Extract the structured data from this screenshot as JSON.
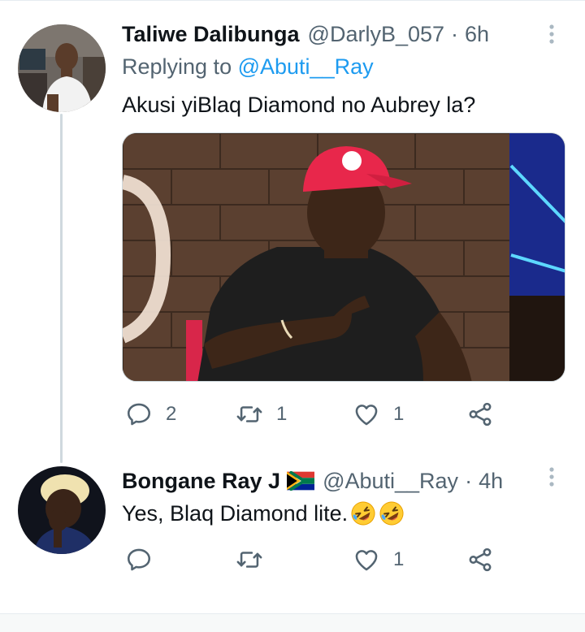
{
  "tweets": [
    {
      "name": "Taliwe Dalibunga",
      "handle": "@DarlyB_057",
      "separator": "·",
      "time": "6h",
      "replying_prefix": "Replying to",
      "replying_handle": "@Abuti__Ray",
      "text": "Akusi yiBlaq Diamond no Aubrey la?",
      "actions": {
        "replies": "2",
        "retweets": "1",
        "likes": "1"
      }
    },
    {
      "name": "Bongane Ray J",
      "flag_icon": "south-africa-flag",
      "handle": "@Abuti__Ray",
      "separator": "·",
      "time": "4h",
      "text": "Yes, Blaq Diamond lite.",
      "emoji_icons": [
        "rolling-on-floor-laughing-emoji",
        "rolling-on-floor-laughing-emoji"
      ],
      "actions": {
        "likes": "1"
      }
    }
  ],
  "colors": {
    "text_primary": "#0f1419",
    "text_secondary": "#536471",
    "accent": "#1d9bf0",
    "thread_line": "#cfd9de"
  }
}
